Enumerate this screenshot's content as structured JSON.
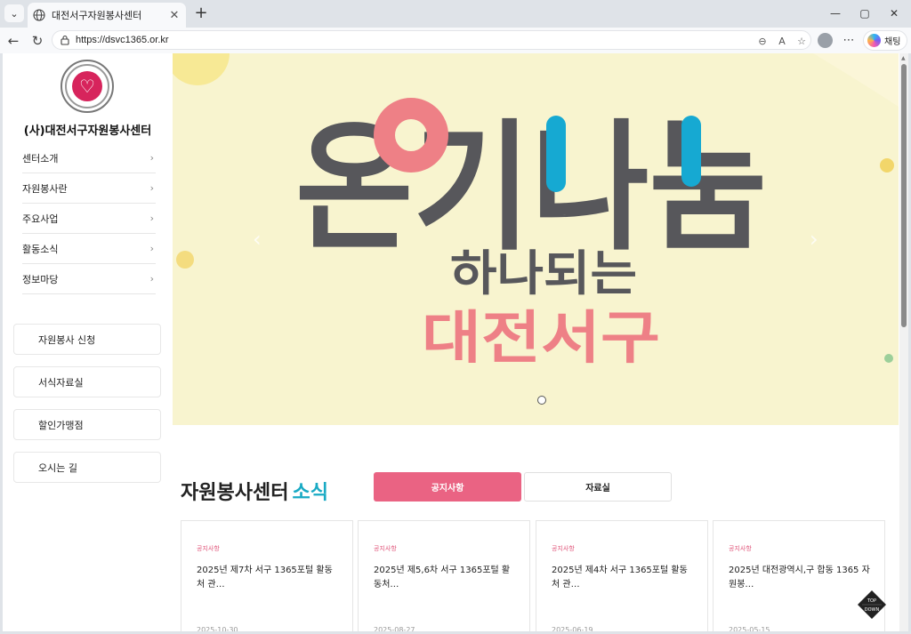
{
  "browser": {
    "tab_title": "대전서구자원봉사센터",
    "url": "https://dsvc1365.or.kr",
    "copilot_label": "채팅"
  },
  "sidebar": {
    "org_name": "(사)대전서구자원봉사센터",
    "menu": [
      {
        "label": "센터소개"
      },
      {
        "label": "자원봉사란"
      },
      {
        "label": "주요사업"
      },
      {
        "label": "활동소식"
      },
      {
        "label": "정보마당"
      }
    ],
    "quick_links": [
      {
        "label": "자원봉사 신청"
      },
      {
        "label": "서식자료실"
      },
      {
        "label": "할인가맹점"
      },
      {
        "label": "오시는 길"
      }
    ]
  },
  "hero": {
    "line1": "온기나눔",
    "line2": "하나되는",
    "line3": "대전서구",
    "colors": {
      "pink": "#ee8086",
      "blue": "#16a9d2",
      "dark": "#57575b",
      "bg": "#f8f4cf"
    }
  },
  "news": {
    "title": "자원봉사센터",
    "title_accent": "소식",
    "tabs": [
      {
        "label": "공지사항",
        "active": true
      },
      {
        "label": "자료실",
        "active": false
      }
    ],
    "cards": [
      {
        "category": "공지사항",
        "title": "2025년 제7차 서구 1365포털 활동처 관…",
        "date": "2025-10-30"
      },
      {
        "category": "공지사항",
        "title": "2025년 제5,6차 서구 1365포털 활동처…",
        "date": "2025-08-27"
      },
      {
        "category": "공지사항",
        "title": "2025년 제4차 서구 1365포털 활동처 관…",
        "date": "2025-06-19"
      },
      {
        "category": "공지사항",
        "title": "2025년 대전광역시,구 합동 1365 자원봉…",
        "date": "2025-05-15"
      }
    ],
    "accent_color": "#19aac4",
    "tab_color": "#ea6383"
  },
  "top_button": {
    "top": "TOP",
    "down": "DOWN"
  }
}
